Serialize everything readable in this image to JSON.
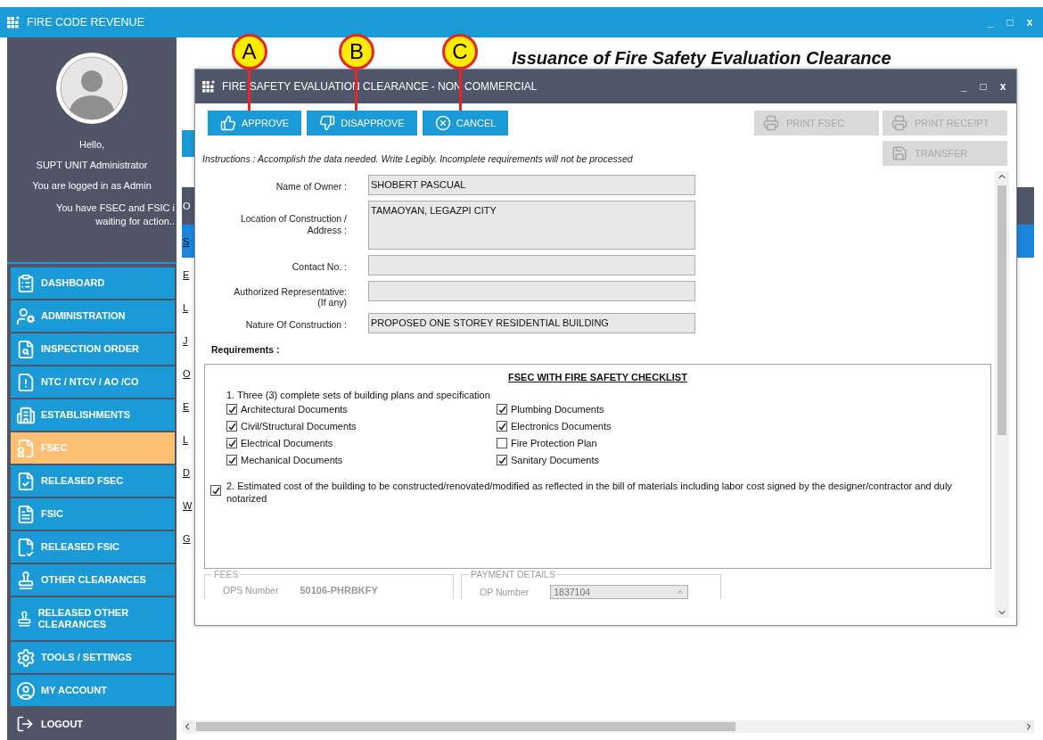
{
  "app_bar": {
    "title": "FIRE CODE REVENUE",
    "controls": [
      "_",
      "□",
      "x"
    ]
  },
  "sidebar": {
    "greeting": "Hello,",
    "user": "SUPT UNIT Administrator",
    "role_line": "You are logged in as Admin",
    "notice_lines": [
      "You have FSEC and FSIC i",
      "waiting for action.."
    ],
    "items": [
      {
        "label": "DASHBOARD",
        "selected": false
      },
      {
        "label": "ADMINISTRATION",
        "selected": false
      },
      {
        "label": "INSPECTION ORDER",
        "selected": false
      },
      {
        "label": "NTC / NTCV / AO /CO",
        "selected": false
      },
      {
        "label": "ESTABLISHMENTS",
        "selected": false
      },
      {
        "label": "FSEC",
        "selected": true
      },
      {
        "label": "RELEASED FSEC",
        "selected": false
      },
      {
        "label": "FSIC",
        "selected": false
      },
      {
        "label": "RELEASED FSIC",
        "selected": false
      },
      {
        "label": "OTHER CLEARANCES",
        "selected": false
      },
      {
        "label": "RELEASED OTHER CLEARANCES",
        "selected": false
      },
      {
        "label": "TOOLS / SETTINGS",
        "selected": false
      },
      {
        "label": "MY ACCOUNT",
        "selected": false
      }
    ],
    "logout": "LOGOUT"
  },
  "page": {
    "title": "Issuance of Fire Safety Evaluation Clearance",
    "list_header": "O",
    "list_rows": [
      {
        "text": "S",
        "selected": true
      },
      {
        "text": "E",
        "selected": false
      },
      {
        "text": "L",
        "selected": false
      },
      {
        "text": "J",
        "selected": false
      },
      {
        "text": "O",
        "selected": false
      },
      {
        "text": "E",
        "selected": false
      },
      {
        "text": "L",
        "selected": false
      },
      {
        "text": "D",
        "selected": false
      },
      {
        "text": "W",
        "selected": false
      },
      {
        "text": "G",
        "selected": false
      }
    ]
  },
  "dialog": {
    "title": "FIRE SAFETY EVALUATION CLEARANCE - NON COMMERCIAL",
    "controls": [
      "_",
      "□",
      "x"
    ],
    "actions": [
      {
        "label": "APPROVE",
        "callout": "A"
      },
      {
        "label": "DISAPPROVE",
        "callout": "B"
      },
      {
        "label": "CANCEL",
        "callout": "C"
      }
    ],
    "side_buttons": [
      {
        "label": "PRINT FSEC",
        "disabled": true
      },
      {
        "label": "PRINT RECEIPT",
        "disabled": true
      },
      {
        "label": "TRANSFER",
        "disabled": true
      }
    ],
    "instructions": "Instructions : Accomplish the data needed. Write Legibly. Incomplete requirements will not be processed",
    "fields": [
      {
        "label": "Name of Owner :",
        "value": "SHOBERT PASCUAL",
        "kind": "line"
      },
      {
        "label": "Location of Construction / Address :",
        "value": "TAMAOYAN, LEGAZPI CITY",
        "kind": "area"
      },
      {
        "label": "Contact No. :",
        "kind": "line"
      },
      {
        "label": "Authorized Representative:",
        "note": "(If any)",
        "kind": "line"
      },
      {
        "label": "Nature Of Construction :",
        "value": "PROPOSED ONE STOREY RESIDENTIAL BUILDING",
        "kind": "line"
      }
    ],
    "requirements_label": "Requirements :",
    "checklist": {
      "heading": "FSEC WITH FIRE SAFETY CHECKLIST",
      "item_1": "1. Three (3) complete sets of building plans and specification",
      "documents": [
        {
          "label": "Architectural Documents",
          "checked": true
        },
        {
          "label": "Plumbing Documents",
          "checked": true
        },
        {
          "label": "Civil/Structural Documents",
          "checked": true
        },
        {
          "label": "Electronics Documents",
          "checked": true
        },
        {
          "label": "Electrical Documents",
          "checked": true
        },
        {
          "label": "Fire Protection Plan",
          "checked": false
        },
        {
          "label": "Mechanical Documents",
          "checked": true
        },
        {
          "label": "Sanitary Documents",
          "checked": true
        }
      ],
      "item_2": {
        "label": "2. Estimated cost of the building to be constructed/renovated/modified as reflected in the bill of materials including labor cost signed by the designer/contractor and duly notarized",
        "checked": true
      }
    },
    "fees": {
      "legend": "FEES",
      "ops_label": "OPS Number",
      "ops_value": "50106-PHRBKFY"
    },
    "payment": {
      "legend": "PAYMENT DETAILS",
      "op_label": "OP Number",
      "op_value": "1837104"
    }
  }
}
